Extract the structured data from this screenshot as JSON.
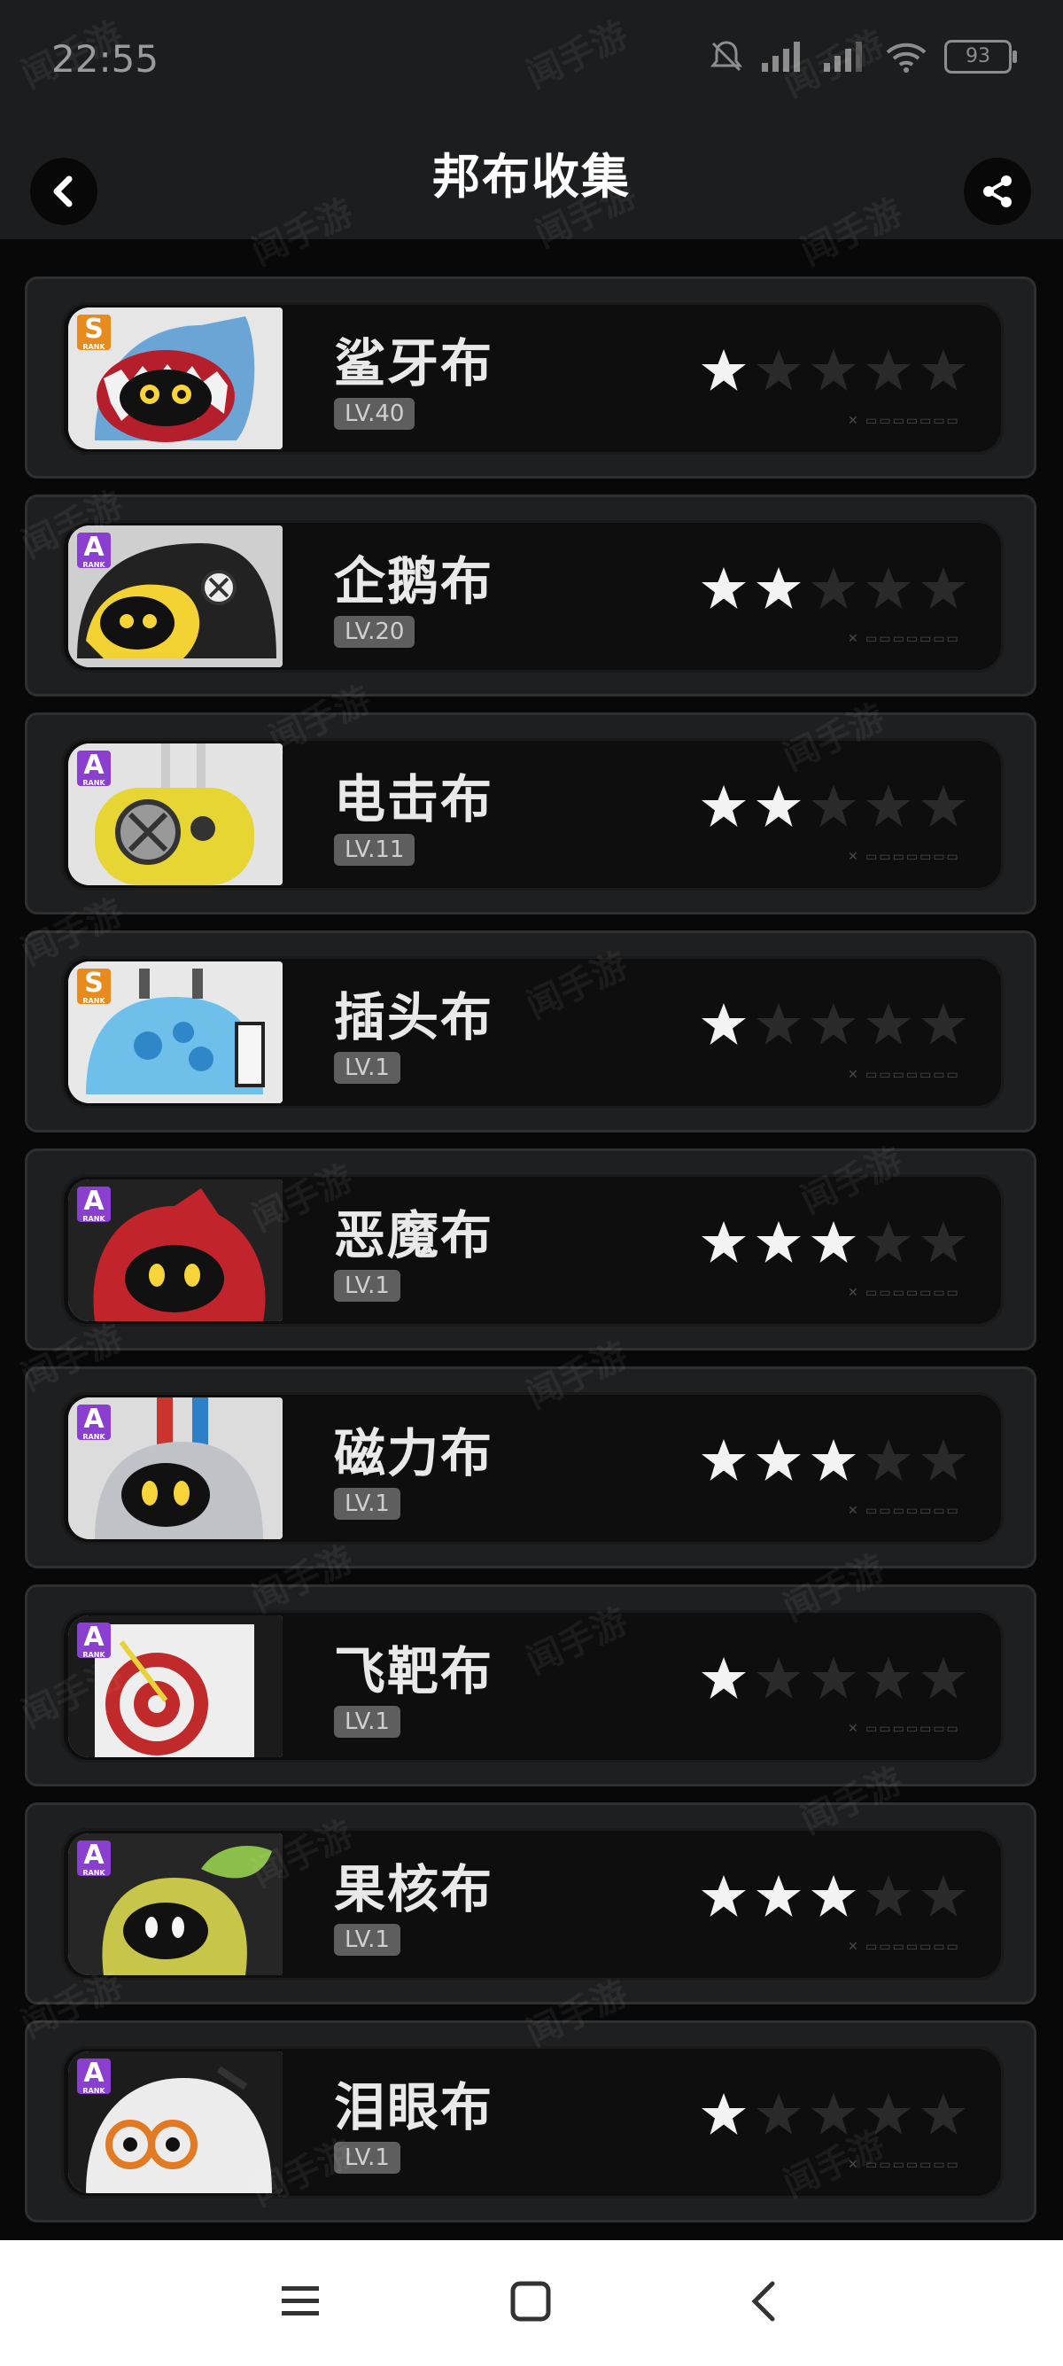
{
  "status": {
    "time": "22:55",
    "battery": "93"
  },
  "header": {
    "title": "邦布收集",
    "back_icon": "chevron-left-icon",
    "share_icon": "share-icon"
  },
  "watermark": "闻手游",
  "items": [
    {
      "name": "鲨牙布",
      "level": "LV.40",
      "rank": "S",
      "stars": 1,
      "portrait": "shark"
    },
    {
      "name": "企鹅布",
      "level": "LV.20",
      "rank": "A",
      "stars": 2,
      "portrait": "penguin"
    },
    {
      "name": "电击布",
      "level": "LV.11",
      "rank": "A",
      "stars": 2,
      "portrait": "electric"
    },
    {
      "name": "插头布",
      "level": "LV.1",
      "rank": "S",
      "stars": 1,
      "portrait": "plug"
    },
    {
      "name": "恶魔布",
      "level": "LV.1",
      "rank": "A",
      "stars": 3,
      "portrait": "devil"
    },
    {
      "name": "磁力布",
      "level": "LV.1",
      "rank": "A",
      "stars": 3,
      "portrait": "magnet"
    },
    {
      "name": "飞靶布",
      "level": "LV.1",
      "rank": "A",
      "stars": 1,
      "portrait": "target"
    },
    {
      "name": "果核布",
      "level": "LV.1",
      "rank": "A",
      "stars": 3,
      "portrait": "fruit"
    },
    {
      "name": "泪眼布",
      "level": "LV.1",
      "rank": "A",
      "stars": 1,
      "portrait": "tear"
    }
  ],
  "navbar": {
    "menu_icon": "menu-icon",
    "home_icon": "home-square-icon",
    "back_icon": "back-triangle-icon"
  }
}
